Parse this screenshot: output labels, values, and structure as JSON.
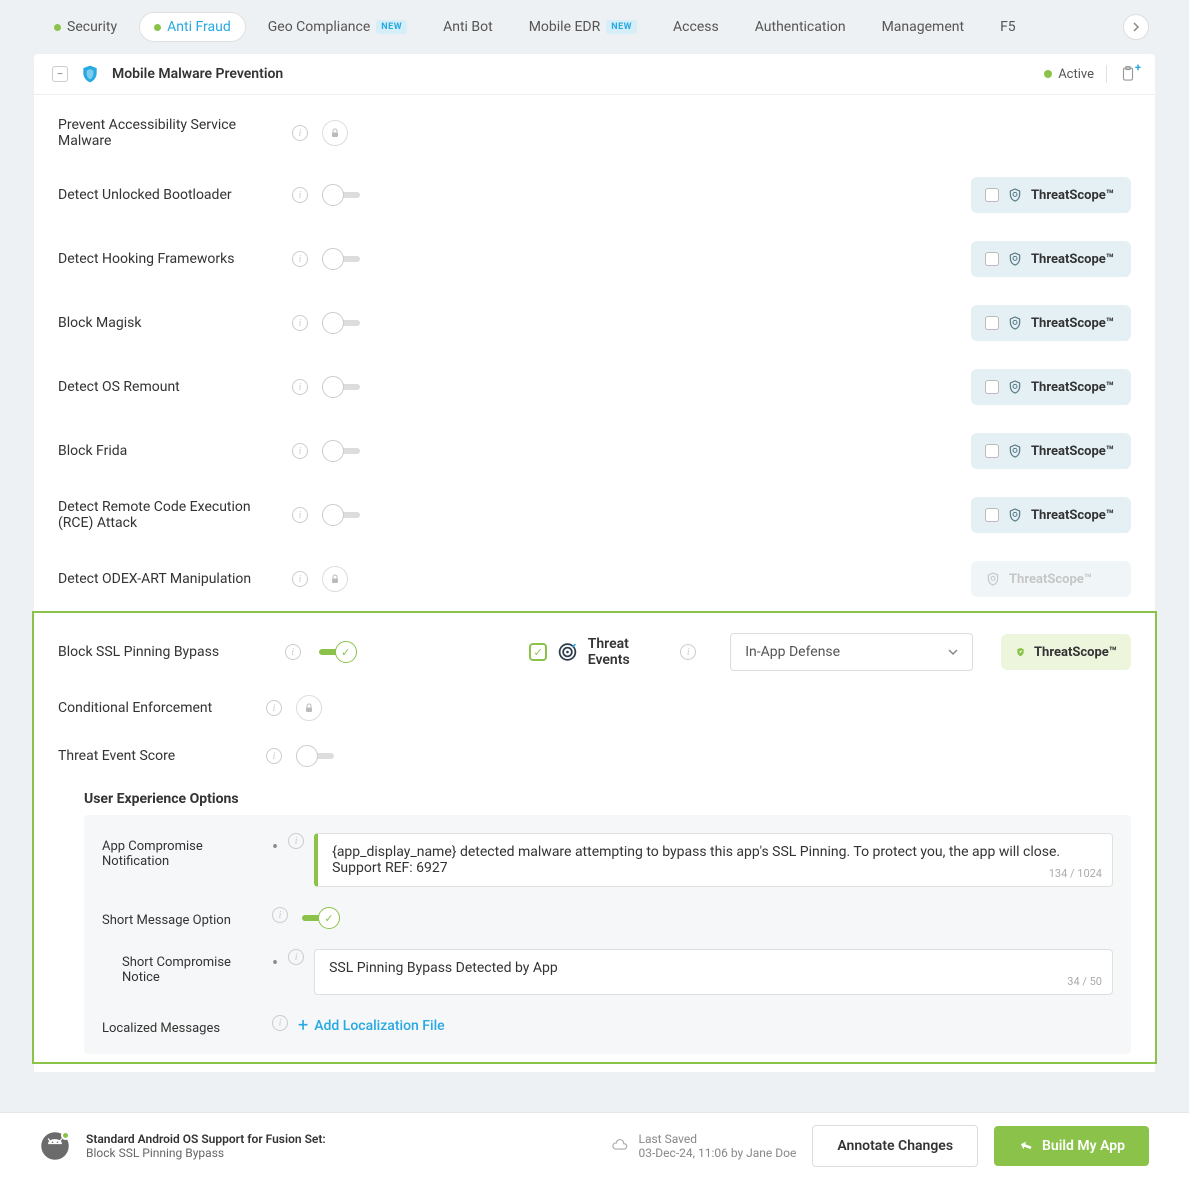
{
  "tabs": [
    {
      "label": "Security",
      "dot": true
    },
    {
      "label": "Anti Fraud",
      "dot": true,
      "active": true
    },
    {
      "label": "Geo Compliance",
      "badge": "NEW"
    },
    {
      "label": "Anti Bot"
    },
    {
      "label": "Mobile EDR",
      "badge": "NEW"
    },
    {
      "label": "Access"
    },
    {
      "label": "Authentication"
    },
    {
      "label": "Management"
    },
    {
      "label": "F5"
    }
  ],
  "panel": {
    "title": "Mobile Malware Prevention",
    "status": "Active"
  },
  "threatscope_label": "ThreatScope™",
  "rows": [
    {
      "label": "Prevent Accessibility Service Malware",
      "locked": true
    },
    {
      "label": "Detect Unlocked Bootloader",
      "toggle": "off",
      "ts": true
    },
    {
      "label": "Detect Hooking Frameworks",
      "toggle": "off",
      "ts": true
    },
    {
      "label": "Block Magisk",
      "toggle": "off",
      "ts": true
    },
    {
      "label": "Detect OS Remount",
      "toggle": "off",
      "ts": true
    },
    {
      "label": "Block Frida",
      "toggle": "off",
      "ts": true
    },
    {
      "label": "Detect Remote Code Execution (RCE) Attack",
      "toggle": "off",
      "ts": true
    },
    {
      "label": "Detect ODEX-ART Manipulation",
      "locked": true,
      "ts": true,
      "ts_disabled": true
    }
  ],
  "expanded": {
    "label": "Block SSL Pinning Bypass",
    "threat_events_label": "Threat Events",
    "select_value": "In-App Defense",
    "conditional_label": "Conditional Enforcement",
    "score_label": "Threat Event Score",
    "ux_header": "User Experience Options",
    "notif_label": "App Compromise Notification",
    "notif_text": "{app_display_name} detected malware attempting to bypass this app's SSL Pinning. To protect you, the app will close. Support REF: 6927",
    "notif_counter": "134 / 1024",
    "short_opt_label": "Short Message Option",
    "short_notice_label": "Short Compromise Notice",
    "short_notice_text": "SSL Pinning Bypass Detected by App",
    "short_notice_counter": "34 / 50",
    "localized_label": "Localized Messages",
    "add_localization": "Add Localization File"
  },
  "footer": {
    "fusion_line1": "Standard Android OS Support for Fusion Set:",
    "fusion_line2": "Block SSL Pinning Bypass",
    "last_saved_label": "Last Saved",
    "last_saved_value": "03-Dec-24, 11:06 by Jane Doe",
    "annotate": "Annotate Changes",
    "build": "Build My App"
  }
}
